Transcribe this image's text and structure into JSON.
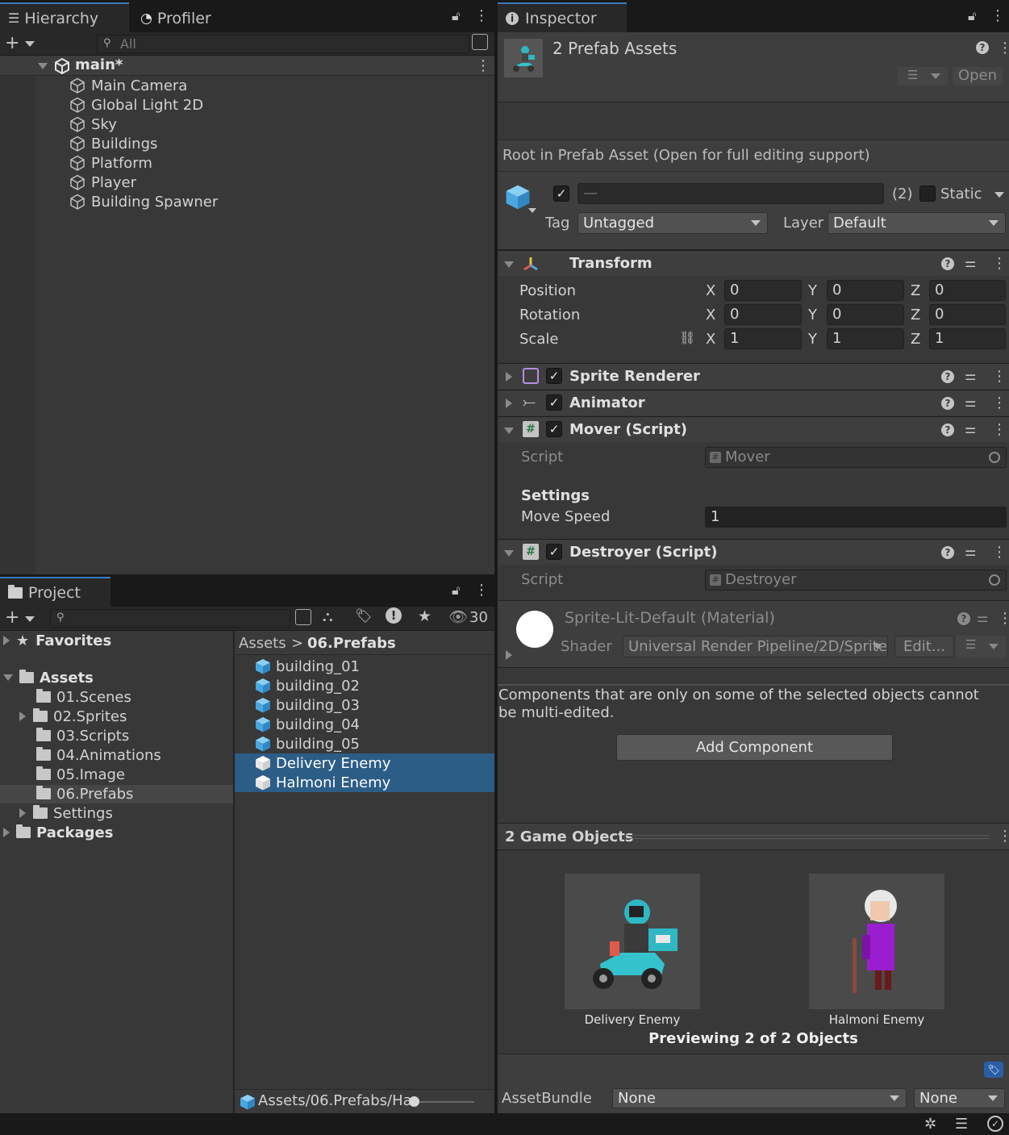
{
  "hierarchy": {
    "tabs": [
      {
        "label": "Hierarchy",
        "icon": "hierarchy-list-icon"
      },
      {
        "label": "Profiler",
        "icon": "profiler-gauge-icon"
      }
    ],
    "search_placeholder": "All",
    "scene": "main*",
    "items": [
      "Main Camera",
      "Global Light 2D",
      "Sky",
      "Buildings",
      "Platform",
      "Player",
      "Building Spawner"
    ]
  },
  "project": {
    "tab": "Project",
    "hidden_count": "30",
    "tree": {
      "favorites": "Favorites",
      "assets": "Assets",
      "folders": [
        "01.Scenes",
        "02.Sprites",
        "03.Scripts",
        "04.Animations",
        "05.Image",
        "06.Prefabs",
        "Settings"
      ],
      "packages": "Packages"
    },
    "breadcrumb": {
      "root": "Assets",
      "separator": ">",
      "current": "06.Prefabs"
    },
    "files": [
      "building_01",
      "building_02",
      "building_03",
      "building_04",
      "building_05",
      "Delivery Enemy",
      "Halmoni Enemy"
    ],
    "selected": [
      "Delivery Enemy",
      "Halmoni Enemy"
    ],
    "status_path": "Assets/06.Prefabs/Ha"
  },
  "inspector": {
    "tab": "Inspector",
    "title": "2 Prefab Assets",
    "open_button": "Open",
    "root_note": "Root in Prefab Asset (Open for full editing support)",
    "name_field": "—",
    "count": "(2)",
    "static_label": "Static",
    "tag_label": "Tag",
    "tag_value": "Untagged",
    "layer_label": "Layer",
    "layer_value": "Default",
    "transform": {
      "title": "Transform",
      "position_label": "Position",
      "rotation_label": "Rotation",
      "scale_label": "Scale",
      "axis_x": "X",
      "axis_y": "Y",
      "axis_z": "Z",
      "position": [
        "0",
        "0",
        "0"
      ],
      "rotation": [
        "0",
        "0",
        "0"
      ],
      "scale": [
        "1",
        "1",
        "1"
      ]
    },
    "sprite_renderer": "Sprite Renderer",
    "animator": "Animator",
    "mover": {
      "title": "Mover (Script)",
      "script_label": "Script",
      "script_value": "Mover",
      "settings_header": "Settings",
      "move_speed_label": "Move Speed",
      "move_speed_value": "1"
    },
    "destroyer": {
      "title": "Destroyer (Script)",
      "script_label": "Script",
      "script_value": "Destroyer"
    },
    "material": {
      "name": "Sprite-Lit-Default (Material)",
      "shader_label": "Shader",
      "shader_value": "Universal Render Pipeline/2D/Sprite",
      "edit_button": "Edit..."
    },
    "multi_edit_note": "Components that are only on some of the selected objects cannot be multi-edited.",
    "add_component": "Add Component",
    "preview": {
      "header": "2 Game Objects",
      "items": [
        "Delivery Enemy",
        "Halmoni Enemy"
      ],
      "footer": "Previewing 2 of 2 Objects"
    },
    "asset_bundle": {
      "label": "AssetBundle",
      "value": "None",
      "variant": "None"
    }
  },
  "colors": {
    "accent": "#3a79bb",
    "selection": "#2c5d87",
    "panel": "#383838",
    "header": "#3e3e3e",
    "cube_blue": "#5ab7ec"
  }
}
